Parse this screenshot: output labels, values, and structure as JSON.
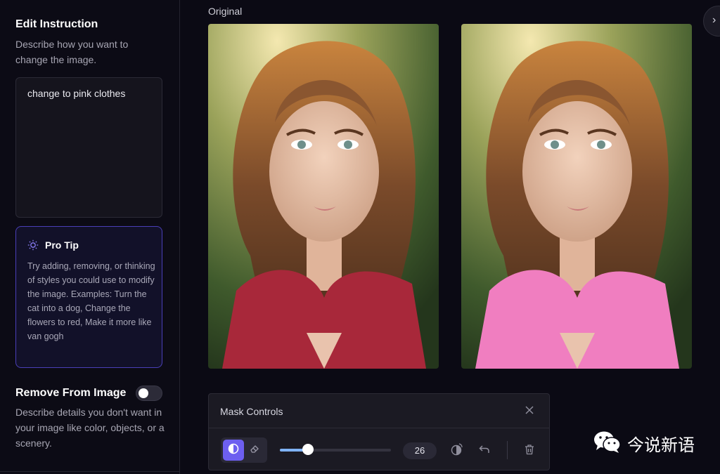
{
  "sidebar": {
    "edit_title": "Edit Instruction",
    "edit_desc": "Describe how you want to change the image.",
    "instruction_value": "change to pink clothes",
    "tip": {
      "title": "Pro Tip",
      "text": "Try adding, removing, or thinking of styles you could use to modify the image. Examples: Turn the cat into a dog, Change the flowers to red, Make it more like van gogh",
      "icon": "sun-icon"
    },
    "remove_title": "Remove From Image",
    "remove_toggle_on": false,
    "remove_desc": "Describe details you don't want in your image like color, objects, or a scenery."
  },
  "main": {
    "original_label": "Original",
    "images": [
      {
        "name": "original-image",
        "clothing_color": "#a8283a"
      },
      {
        "name": "edited-image",
        "clothing_color": "#f07ec0"
      }
    ]
  },
  "mask_controls": {
    "title": "Mask Controls",
    "brush_size": "26",
    "brush_fraction": 0.25,
    "tools": [
      "brush-mask-icon",
      "eraser-icon"
    ],
    "actions": [
      "invert-mask-icon",
      "undo-icon",
      "trash-icon"
    ]
  },
  "watermark": {
    "text": "今说新语"
  },
  "colors": {
    "accent": "#6d5ff0",
    "slider": "#7fb2f5",
    "tip_border": "#4a3fb8"
  }
}
